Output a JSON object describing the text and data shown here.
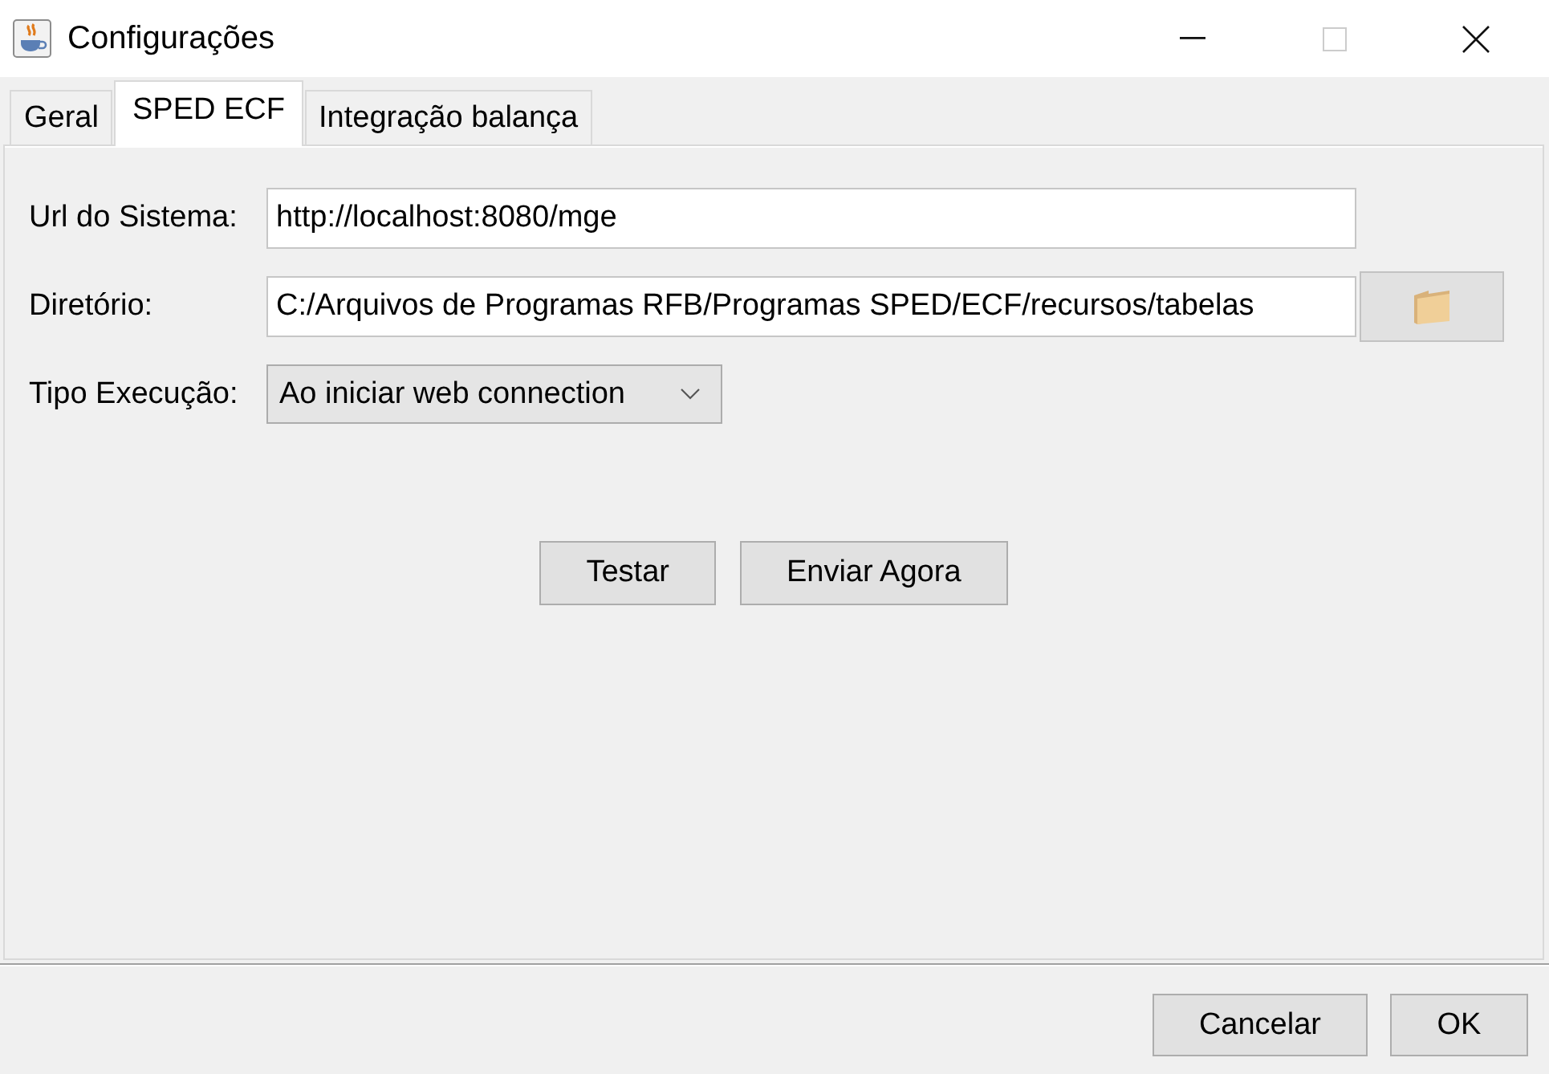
{
  "window": {
    "title": "Configurações",
    "controls": [
      {
        "kind": "minimize",
        "disabled": false
      },
      {
        "kind": "maximize",
        "disabled": true
      },
      {
        "kind": "close",
        "disabled": false
      }
    ]
  },
  "tabs": [
    {
      "label": "Geral",
      "selected": false
    },
    {
      "label": "SPED ECF",
      "selected": true
    },
    {
      "label": "Integração balança",
      "selected": false
    }
  ],
  "form": {
    "fields": [
      {
        "kind": "text",
        "label": "Url do Sistema:",
        "value": "http://localhost:8080/mge"
      },
      {
        "kind": "path",
        "label": "Diretório:",
        "value": "C:/Arquivos de Programas RFB/Programas SPED/ECF/recursos/tabelas"
      },
      {
        "kind": "select",
        "label": "Tipo Execução:",
        "value": "Ao iniciar web connection"
      }
    ],
    "actions": [
      "Testar",
      "Enviar Agora"
    ]
  },
  "buttons": [
    "Cancelar",
    "OK"
  ]
}
